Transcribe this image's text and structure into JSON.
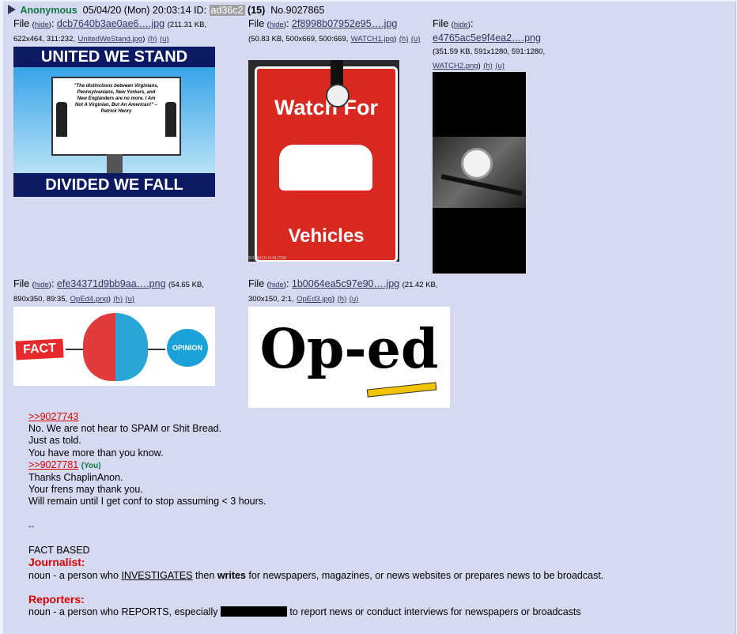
{
  "header": {
    "name": "Anonymous",
    "datetime": "05/04/20 (Mon) 20:03:14",
    "id_label": "ID:",
    "id_value": "ad36c2",
    "post_count": "(15)",
    "post_no": "No.9027865"
  },
  "files": [
    {
      "label": "File",
      "hide": "hide",
      "name": "dcb7640b3ae0ae6….jpg",
      "meta": "(211.31 KB, 622x464, 311:232,",
      "orig": "UnitedWeStand.jpg",
      "h": "(h)",
      "u": "(u)",
      "image": {
        "top_text": "UNITED WE STAND",
        "bottom_text": "DIVIDED WE FALL",
        "quote": "\"The distinctions between Virginians, Pennsylvanians, New Yorkers, and New Englanders are no more. I Am Not A Virginian, But An American!\" – Patrick Henry"
      }
    },
    {
      "label": "File",
      "hide": "hide",
      "name": "2f8998b07952e95….jpg",
      "meta": "(50.83 KB, 500x669, 500:669,",
      "orig": "WATCH1.jpg",
      "h": "(h)",
      "u": "(u)",
      "image": {
        "top_text": "Watch For",
        "bottom_text": "Vehicles",
        "credit": "SO MUCH FUN.COM"
      }
    },
    {
      "label": "File",
      "hide": "hide",
      "name": "e4765ac5e9f4ea2….png",
      "meta": "(351.59 KB, 591x1280, 591:1280,",
      "orig": "WATCH2.png",
      "h": "(h)",
      "u": "(u)"
    },
    {
      "label": "File",
      "hide": "hide",
      "name": "efe34371d9bb9aa….png",
      "meta": "(54.65 KB, 890x350, 89:35,",
      "orig": "OpEd4.png",
      "h": "(h)",
      "u": "(u)",
      "image": {
        "left": "FACT",
        "right": "OPINION"
      }
    },
    {
      "label": "File",
      "hide": "hide",
      "name": "1b0064ea5c97e90….jpg",
      "meta": "(21.42 KB, 300x150, 2:1,",
      "orig": "OpEd3.jpg",
      "h": "(h)",
      "u": "(u)",
      "image": {
        "text": "Op-ed"
      }
    }
  ],
  "body": {
    "quote1": ">>9027743",
    "l1": "No. We are not hear to SPAM or Shit Bread.",
    "l2": "Just as told.",
    "l3": "You have more than you know.",
    "quote2": ">>9027781",
    "you": "(You)",
    "l4": "Thanks ChaplinAnon.",
    "l5": "Your frens may thank you.",
    "l6": "Will remain until I get conf to stop assuming < 3 hours.",
    "sep": "--",
    "l7": "FACT BASED",
    "h1": "Journalist:",
    "j_pre": "noun - a person who ",
    "j_u": "INVESTIGATES",
    "j_mid": " then ",
    "j_b": "writes",
    "j_post": " for newspapers, magazines, or news websites or prepares news to be broadcast.",
    "h2": "Reporters:",
    "r_pre": "noun - a person who REPORTS, especially ",
    "r_post": " to report news or conduct interviews for newspapers or broadcasts"
  }
}
